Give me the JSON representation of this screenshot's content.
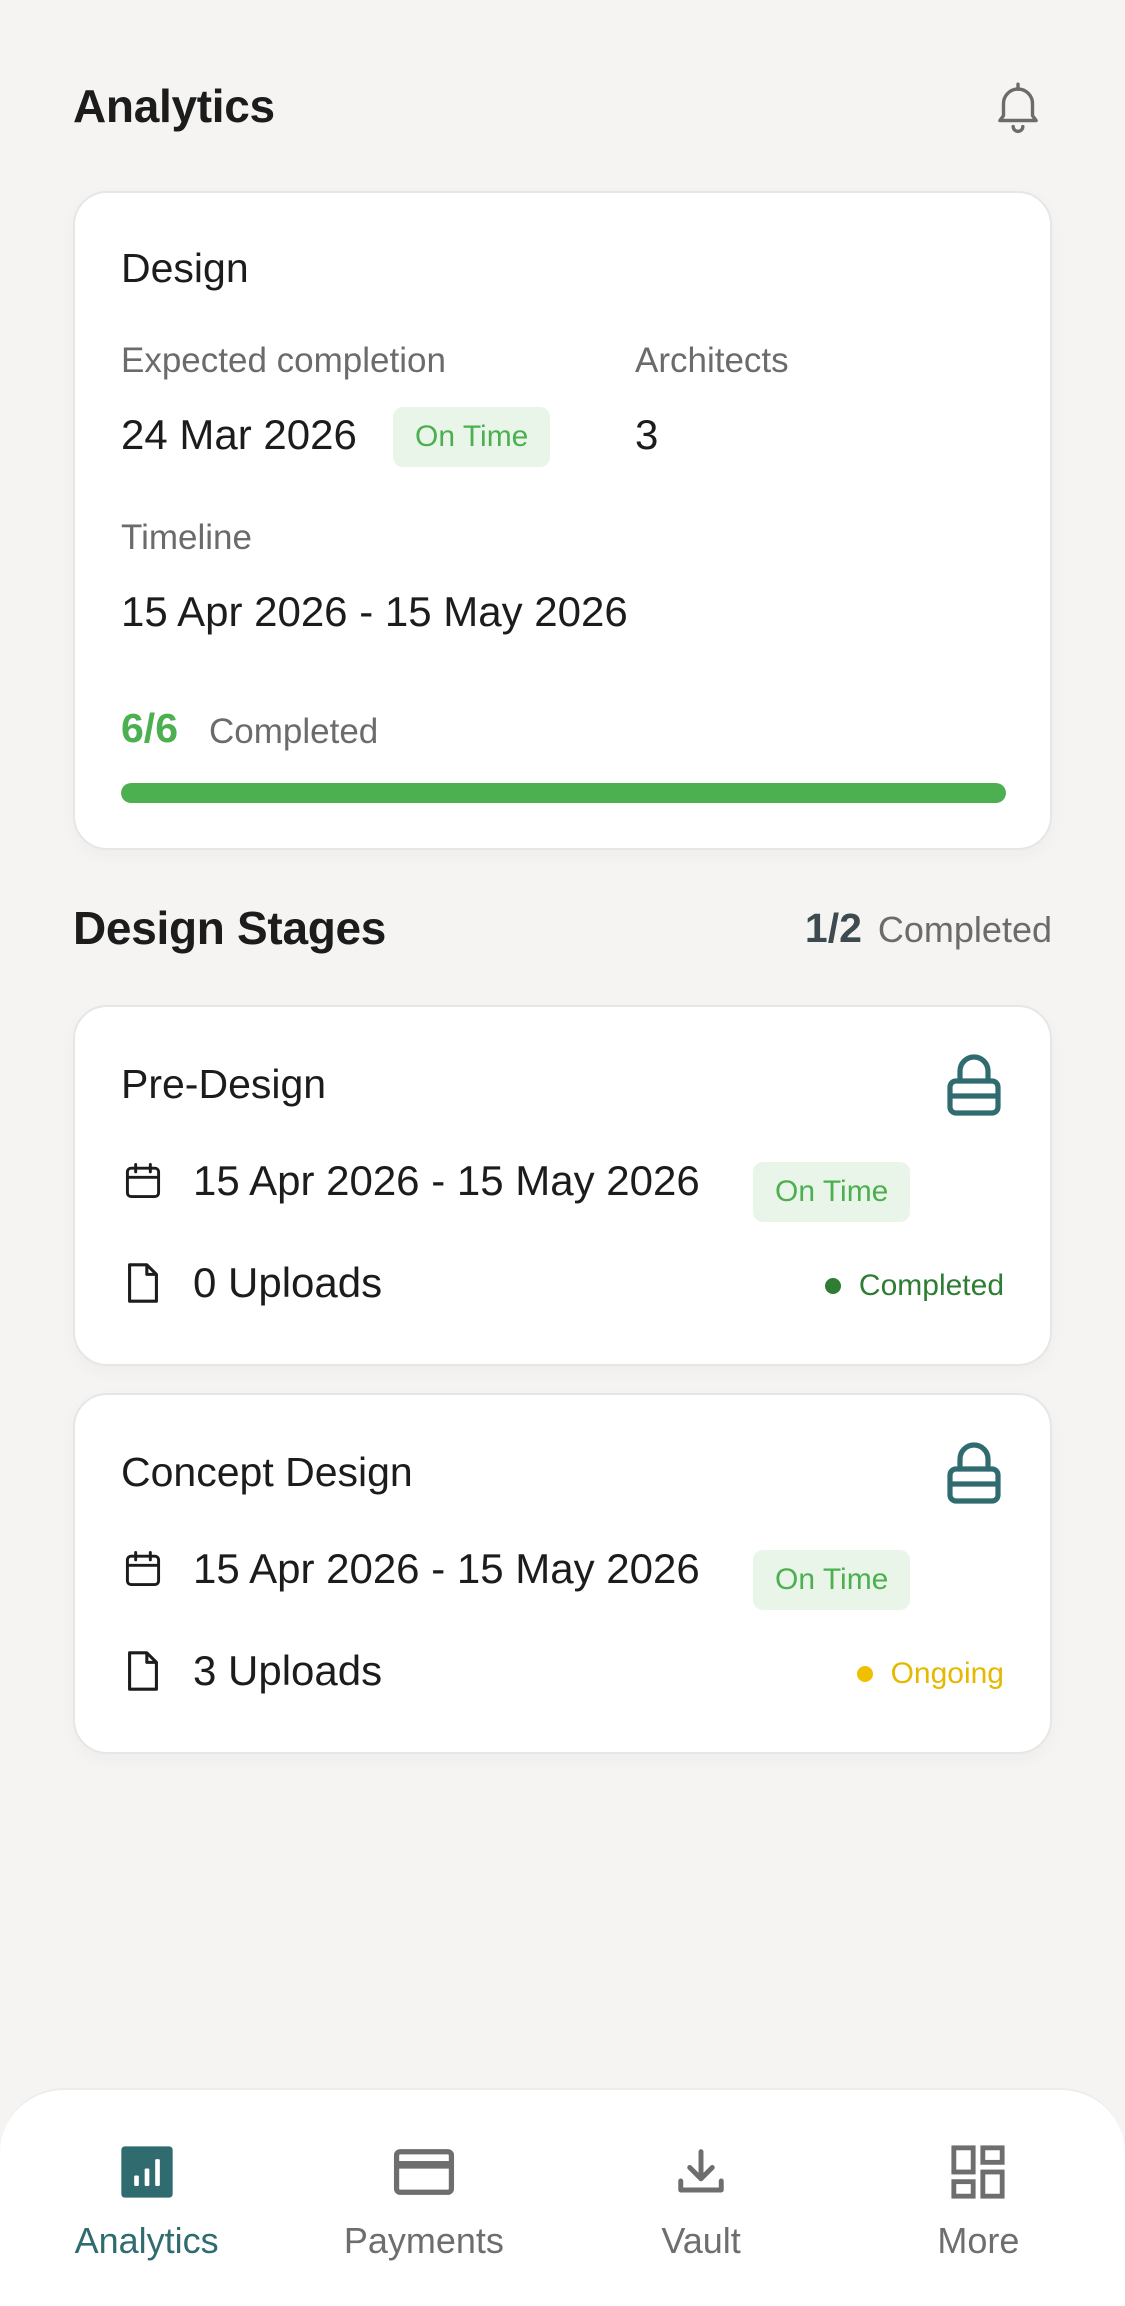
{
  "header": {
    "title": "Analytics"
  },
  "summary": {
    "title": "Design",
    "expected_label": "Expected completion",
    "expected_value": "24 Mar 2026",
    "expected_badge": "On Time",
    "architects_label": "Architects",
    "architects_value": "3",
    "timeline_label": "Timeline",
    "timeline_value": "15 Apr 2026 - 15 May 2026",
    "progress_count": "6/6",
    "progress_label": "Completed",
    "progress_fraction": 1.0,
    "progress_color": "#4caf50"
  },
  "stages": {
    "title": "Design Stages",
    "count": "1/2",
    "count_label": "Completed",
    "items": [
      {
        "name": "Pre-Design",
        "dates": "15 Apr 2026 - 15 May 2026",
        "badge": "On Time",
        "uploads": "0 Uploads",
        "status": "Completed",
        "status_color": "#2e7d32"
      },
      {
        "name": "Concept Design",
        "dates": "15 Apr 2026 - 15 May 2026",
        "badge": "On Time",
        "uploads": "3 Uploads",
        "status": "Ongoing",
        "status_color": "#f0c000"
      }
    ]
  },
  "nav": {
    "items": [
      {
        "label": "Analytics",
        "icon": "bar-chart-icon",
        "active": true
      },
      {
        "label": "Payments",
        "icon": "credit-card-icon",
        "active": false
      },
      {
        "label": "Vault",
        "icon": "download-icon",
        "active": false
      },
      {
        "label": "More",
        "icon": "grid-icon",
        "active": false
      }
    ]
  },
  "colors": {
    "accent": "#2f6b6f",
    "success": "#4caf50",
    "warning": "#f0c000",
    "background": "#f5f4f2"
  }
}
